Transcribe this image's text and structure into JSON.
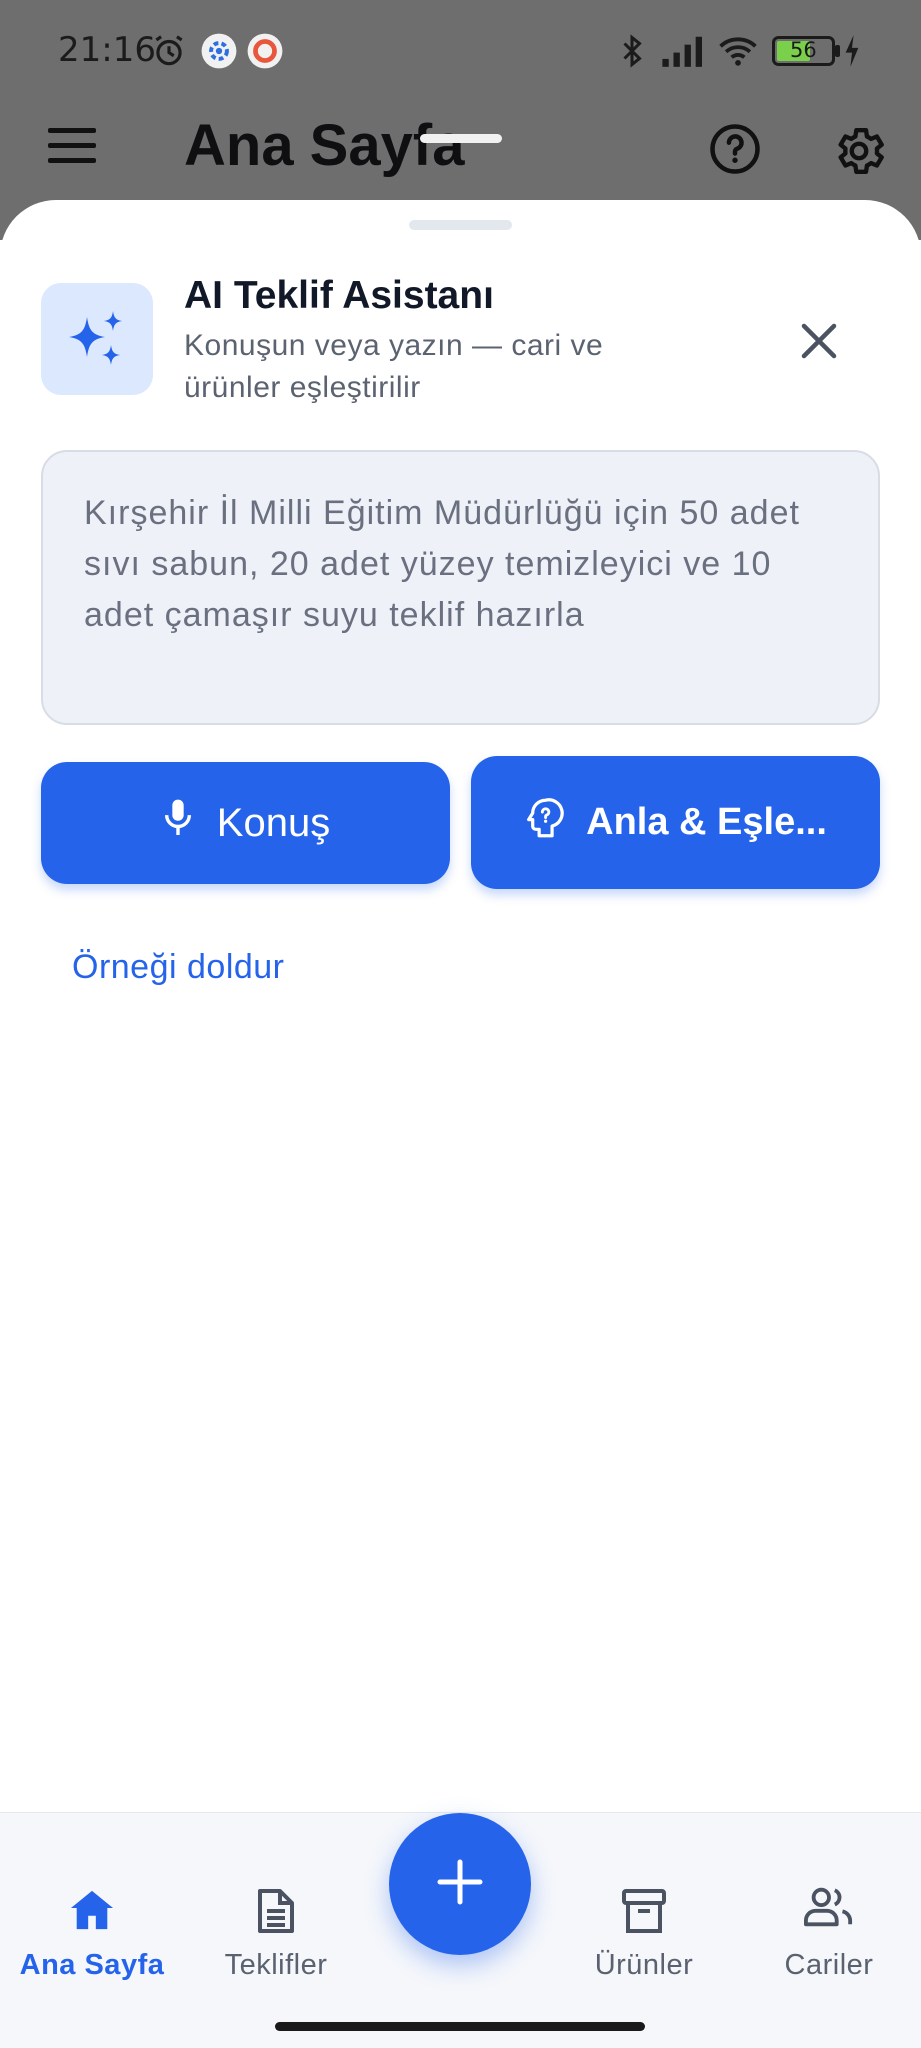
{
  "status_bar": {
    "time": "21:16",
    "battery": "56",
    "icons": [
      "alarm-icon",
      "gear-notification-icon",
      "record-notification-icon",
      "bluetooth-icon",
      "signal-icon",
      "wifi-icon",
      "battery-icon",
      "charging-icon"
    ]
  },
  "app_bar": {
    "title": "Ana Sayfa",
    "icons": [
      "menu-icon",
      "help-icon",
      "settings-icon"
    ]
  },
  "sheet": {
    "title": "AI Teklif Asistanı",
    "subtitle": "Konuşun veya yazın — cari ve ürünler eşleştirilir",
    "prompt_value": "Kırşehir İl Milli Eğitim Müdürlüğü için 50 adet sıvı sabun, 20 adet yüzey temizleyici ve 10 adet çamaşır suyu teklif hazırla",
    "speak_button": "Konuş",
    "match_button": "Anla & Eşle...",
    "fill_example_link": "Örneği doldur"
  },
  "bottom_nav": {
    "items": [
      {
        "label": "Ana Sayfa",
        "icon": "home-icon",
        "active": true
      },
      {
        "label": "Teklifler",
        "icon": "document-icon",
        "active": false
      },
      {
        "label": "Ürünler",
        "icon": "archive-icon",
        "active": false
      },
      {
        "label": "Cariler",
        "icon": "people-icon",
        "active": false
      }
    ],
    "fab_icon": "plus-icon"
  },
  "colors": {
    "accent": "#2563eb",
    "scrim": "#6e6e6e",
    "badge_bg": "#dbe8fd",
    "input_bg": "#eef1f7",
    "nav_bg": "#f5f7fb"
  }
}
